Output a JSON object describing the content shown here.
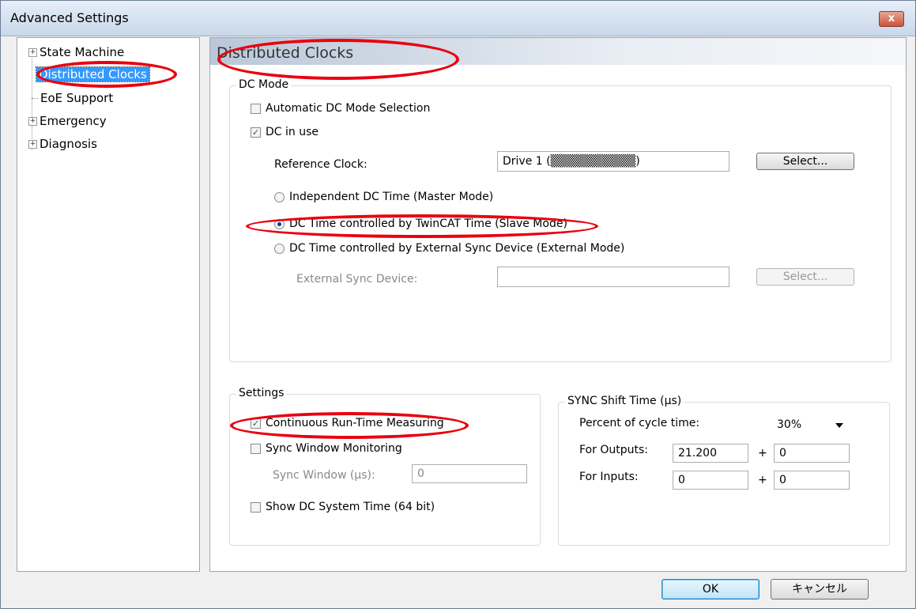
{
  "window": {
    "title": "Advanced Settings",
    "close_label": "x"
  },
  "tree": {
    "items": [
      {
        "label": "State Machine",
        "expander": "+"
      },
      {
        "label": "Distributed Clocks"
      },
      {
        "label": "EoE Support"
      },
      {
        "label": "Emergency",
        "expander": "+"
      },
      {
        "label": "Diagnosis",
        "expander": "+"
      }
    ]
  },
  "panel": {
    "title": "Distributed Clocks",
    "dc_mode": {
      "legend": "DC Mode",
      "auto_label": "Automatic DC Mode Selection",
      "auto_checked": false,
      "inuse_label": "DC in use",
      "inuse_checked": true,
      "ref_clock_label": "Reference Clock:",
      "ref_clock_value": "Drive 1 (▒▒▒▒▒▒▒▒▒▒)",
      "select_label": "Select...",
      "radio_independent": "Independent DC Time (Master Mode)",
      "radio_twincat": "DC Time controlled by TwinCAT Time (Slave Mode)",
      "radio_external": "DC Time controlled by External Sync Device (External Mode)",
      "ext_sync_label": "External Sync Device:",
      "ext_sync_value": "",
      "ext_select_label": "Select..."
    },
    "settings": {
      "legend": "Settings",
      "continuous_label": "Continuous Run-Time Measuring",
      "continuous_checked": true,
      "sync_window_monitoring_label": "Sync Window Monitoring",
      "sync_window_monitoring_checked": false,
      "sync_window_label": "Sync Window (μs):",
      "sync_window_value": "0",
      "show_dc_label": "Show DC System Time (64 bit)",
      "show_dc_checked": false
    },
    "sync_shift": {
      "legend": "SYNC Shift Time (μs)",
      "percent_label": "Percent of cycle time:",
      "percent_value": "30%",
      "outputs_label": "For Outputs:",
      "outputs_value": "21.200",
      "outputs_plus": "+",
      "outputs_offset": "0",
      "inputs_label": "For Inputs:",
      "inputs_value": "0",
      "inputs_plus": "+",
      "inputs_offset": "0"
    }
  },
  "buttons": {
    "ok_label": "OK",
    "cancel_label": "キャンセル"
  },
  "colors": {
    "highlight": "#e8000f",
    "selection": "#3399ff"
  }
}
